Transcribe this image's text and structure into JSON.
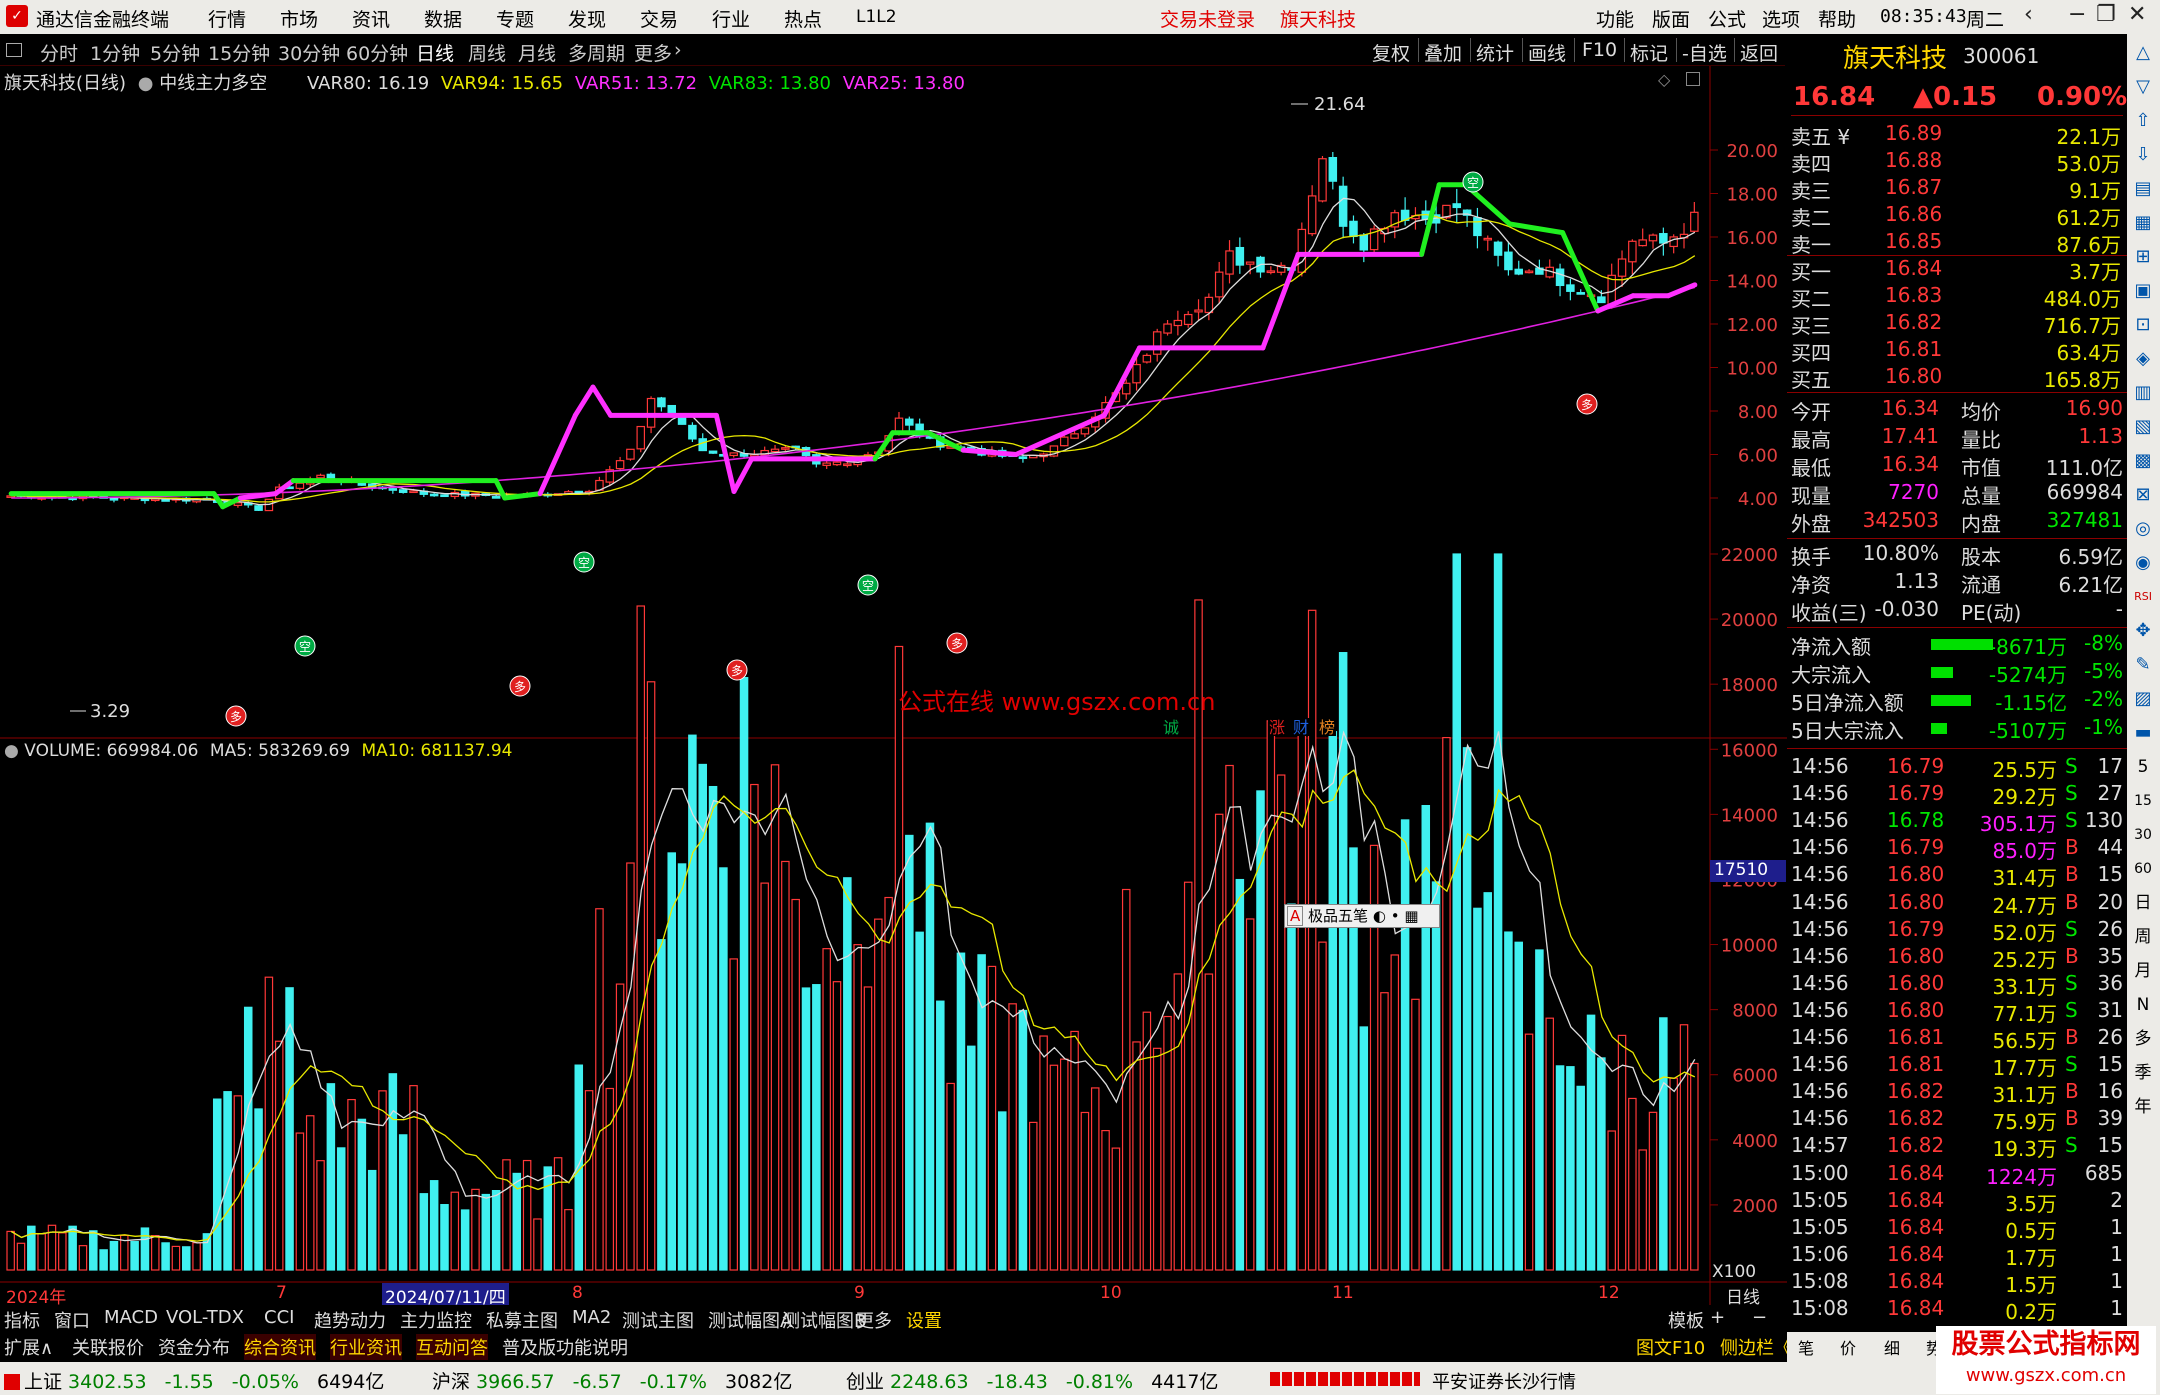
{
  "titlebar": {
    "app_title": "通达信金融终端",
    "menus": [
      "行情",
      "市场",
      "资讯",
      "数据",
      "专题",
      "发现",
      "交易",
      "行业",
      "热点",
      "L1L2"
    ],
    "trade_status": "交易未登录",
    "stock_name": "旗天科技",
    "right_menus": [
      "功能",
      "版面",
      "公式",
      "选项",
      "帮助"
    ],
    "time": "08:35:43",
    "weekday": "周二"
  },
  "periodbar": {
    "periods": [
      "分时",
      "1分钟",
      "5分钟",
      "15分钟",
      "30分钟",
      "60分钟",
      "日线",
      "周线",
      "月线",
      "多周期",
      "更多"
    ],
    "active": "日线",
    "tools": [
      "复权",
      "叠加",
      "统计",
      "画线",
      "F10",
      "标记",
      "-自选",
      "返回"
    ]
  },
  "chart": {
    "main_title": "旗天科技(日线)",
    "indicator_name": "中线主力多空",
    "vars": [
      {
        "label": "VAR80: 16.19",
        "color": "#DDDDDD"
      },
      {
        "label": "VAR94: 15.65",
        "color": "#E8E800"
      },
      {
        "label": "VAR51: 13.72",
        "color": "#FF30FF"
      },
      {
        "label": "VAR83: 13.80",
        "color": "#00E600"
      },
      {
        "label": "VAR25: 13.80",
        "color": "#FF30FF"
      }
    ],
    "price_axis": [
      "20.00",
      "18.00",
      "16.00",
      "14.00",
      "12.00",
      "10.00",
      "8.00",
      "6.00",
      "4.00"
    ],
    "max_label": "21.64",
    "min_label": "3.29",
    "watermark": "公式在线 www.gszx.com.cn",
    "kong_label": "空",
    "duo_label": "多",
    "markers": [
      "诚",
      "涨",
      "财",
      "榜"
    ],
    "volume_title": "VOLUME: 669984.06",
    "ma5": "MA5: 583269.69",
    "ma10": "MA10: 681137.94",
    "vol_axis": [
      "22000",
      "20000",
      "18000",
      "16000",
      "14000",
      "12000",
      "10000",
      "8000",
      "6000",
      "4000",
      "2000"
    ],
    "vol_cursor": "17510",
    "vol_unit": "X100",
    "x_labels": [
      "2024年",
      "7",
      "2024/07/11/四",
      "8",
      "9",
      "10",
      "11",
      "12"
    ],
    "x_period": "日线",
    "popup": "极品五笔"
  },
  "quote": {
    "name": "旗天科技",
    "code": "300061",
    "price": "16.84",
    "change": "▲0.15",
    "pct": "0.90%",
    "asks": [
      {
        "label": "卖五 ¥",
        "price": "16.89",
        "vol": "22.1万"
      },
      {
        "label": "卖四",
        "price": "16.88",
        "vol": "53.0万"
      },
      {
        "label": "卖三",
        "price": "16.87",
        "vol": "9.1万"
      },
      {
        "label": "卖二",
        "price": "16.86",
        "vol": "61.2万"
      },
      {
        "label": "卖一",
        "price": "16.85",
        "vol": "87.6万"
      }
    ],
    "bids": [
      {
        "label": "买一",
        "price": "16.84",
        "vol": "3.7万"
      },
      {
        "label": "买二",
        "price": "16.83",
        "vol": "484.0万"
      },
      {
        "label": "买三",
        "price": "16.82",
        "vol": "716.7万"
      },
      {
        "label": "买四",
        "price": "16.81",
        "vol": "63.4万"
      },
      {
        "label": "买五",
        "price": "16.80",
        "vol": "165.8万"
      }
    ],
    "stats": [
      {
        "l1": "今开",
        "v1": "16.34",
        "c1": "red",
        "l2": "均价",
        "v2": "16.90",
        "c2": "red"
      },
      {
        "l1": "最高",
        "v1": "17.41",
        "c1": "red",
        "l2": "量比",
        "v2": "1.13",
        "c2": "red"
      },
      {
        "l1": "最低",
        "v1": "16.34",
        "c1": "red",
        "l2": "市值",
        "v2": "111.0亿",
        "c2": "wht"
      },
      {
        "l1": "现量",
        "v1": "7270",
        "c1": "mag",
        "l2": "总量",
        "v2": "669984",
        "c2": "wht"
      },
      {
        "l1": "外盘",
        "v1": "342503",
        "c1": "red",
        "l2": "内盘",
        "v2": "327481",
        "c2": "grn"
      }
    ],
    "stats2": [
      {
        "l1": "换手",
        "v1": "10.80%",
        "l2": "股本",
        "v2": "6.59亿"
      },
      {
        "l1": "净资",
        "v1": "1.13",
        "l2": "流通",
        "v2": "6.21亿"
      },
      {
        "l1": "收益(三)",
        "v1": "-0.030",
        "l2": "PE(动)",
        "v2": "-"
      }
    ],
    "flows": [
      {
        "label": "净流入额",
        "value": "-8671万",
        "pct": "-8%"
      },
      {
        "label": "大宗流入",
        "value": "-5274万",
        "pct": "-5%"
      },
      {
        "label": "5日净流入额",
        "value": "-1.15亿",
        "pct": "-2%"
      },
      {
        "label": "5日大宗流入",
        "value": "-5107万",
        "pct": "-1%"
      }
    ],
    "ticks": [
      {
        "t": "14:56",
        "p": "16.79",
        "v": "25.5万",
        "s": "S",
        "n": "17"
      },
      {
        "t": "14:56",
        "p": "16.79",
        "v": "29.2万",
        "s": "S",
        "n": "27"
      },
      {
        "t": "14:56",
        "p": "16.78",
        "v": "305.1万",
        "s": "S",
        "n": "130"
      },
      {
        "t": "14:56",
        "p": "16.79",
        "v": "85.0万",
        "s": "B",
        "n": "44"
      },
      {
        "t": "14:56",
        "p": "16.80",
        "v": "31.4万",
        "s": "B",
        "n": "15"
      },
      {
        "t": "14:56",
        "p": "16.80",
        "v": "24.7万",
        "s": "B",
        "n": "20"
      },
      {
        "t": "14:56",
        "p": "16.79",
        "v": "52.0万",
        "s": "S",
        "n": "26"
      },
      {
        "t": "14:56",
        "p": "16.80",
        "v": "25.2万",
        "s": "B",
        "n": "35"
      },
      {
        "t": "14:56",
        "p": "16.80",
        "v": "33.1万",
        "s": "S",
        "n": "36"
      },
      {
        "t": "14:56",
        "p": "16.80",
        "v": "77.1万",
        "s": "S",
        "n": "31"
      },
      {
        "t": "14:56",
        "p": "16.81",
        "v": "56.5万",
        "s": "B",
        "n": "26"
      },
      {
        "t": "14:56",
        "p": "16.81",
        "v": "17.7万",
        "s": "S",
        "n": "15"
      },
      {
        "t": "14:56",
        "p": "16.82",
        "v": "31.1万",
        "s": "B",
        "n": "16"
      },
      {
        "t": "14:56",
        "p": "16.82",
        "v": "75.9万",
        "s": "B",
        "n": "39"
      },
      {
        "t": "14:57",
        "p": "16.82",
        "v": "19.3万",
        "s": "S",
        "n": "15"
      },
      {
        "t": "15:00",
        "p": "16.84",
        "v": "1224万",
        "s": "",
        "n": "685"
      },
      {
        "t": "15:05",
        "p": "16.84",
        "v": "3.5万",
        "s": "",
        "n": "2"
      },
      {
        "t": "15:05",
        "p": "16.84",
        "v": "0.5万",
        "s": "",
        "n": "1"
      },
      {
        "t": "15:06",
        "p": "16.84",
        "v": "1.7万",
        "s": "",
        "n": "1"
      },
      {
        "t": "15:08",
        "p": "16.84",
        "v": "1.5万",
        "s": "",
        "n": "1"
      },
      {
        "t": "15:08",
        "p": "16.84",
        "v": "0.2万",
        "s": "",
        "n": "1"
      }
    ]
  },
  "tabs1": [
    "指标",
    "窗口",
    "MACD",
    "VOL-TDX",
    "CCI",
    "趋势动力",
    "主力监控",
    "私募主图",
    "MA2",
    "测试主图",
    "测试幅图A",
    "测试幅图B",
    "更多",
    "设置"
  ],
  "tabs1_right": [
    "模板",
    "+",
    "−"
  ],
  "tabs2": [
    "扩展∧",
    "关联报价",
    "资金分布",
    "综合资讯",
    "行业资讯",
    "互动问答",
    "普及版功能说明"
  ],
  "tabs2_right": [
    "图文F10",
    "侧边栏《",
    "笔",
    "价",
    "细",
    "势"
  ],
  "sidebar_icons": [
    "△",
    "▽",
    "⇧",
    "⇩",
    "▤",
    "▦",
    "⊞",
    "▣",
    "⊡",
    "◈",
    "▥",
    "▧",
    "▩",
    "⊠",
    "◎",
    "◉",
    "RSI",
    "✥",
    "✎",
    "▨",
    "▬",
    "5",
    "15",
    "30",
    "60",
    "日",
    "周",
    "月",
    "N",
    "多",
    "季",
    "年"
  ],
  "status": {
    "idx": [
      {
        "name": "上证",
        "val": "3402.53",
        "chg": "-1.55",
        "pct": "-0.05%",
        "amt": "6494亿"
      },
      {
        "name": "沪深",
        "val": "3966.57",
        "chg": "-6.57",
        "pct": "-0.17%",
        "amt": "3082亿"
      },
      {
        "name": "创业",
        "val": "2248.63",
        "chg": "-18.43",
        "pct": "-0.81%",
        "amt": "4417亿"
      }
    ],
    "broker": "平安证券长沙行情",
    "logo": "股票公式指标网",
    "logo_url": "www.gszx.com.cn"
  }
}
